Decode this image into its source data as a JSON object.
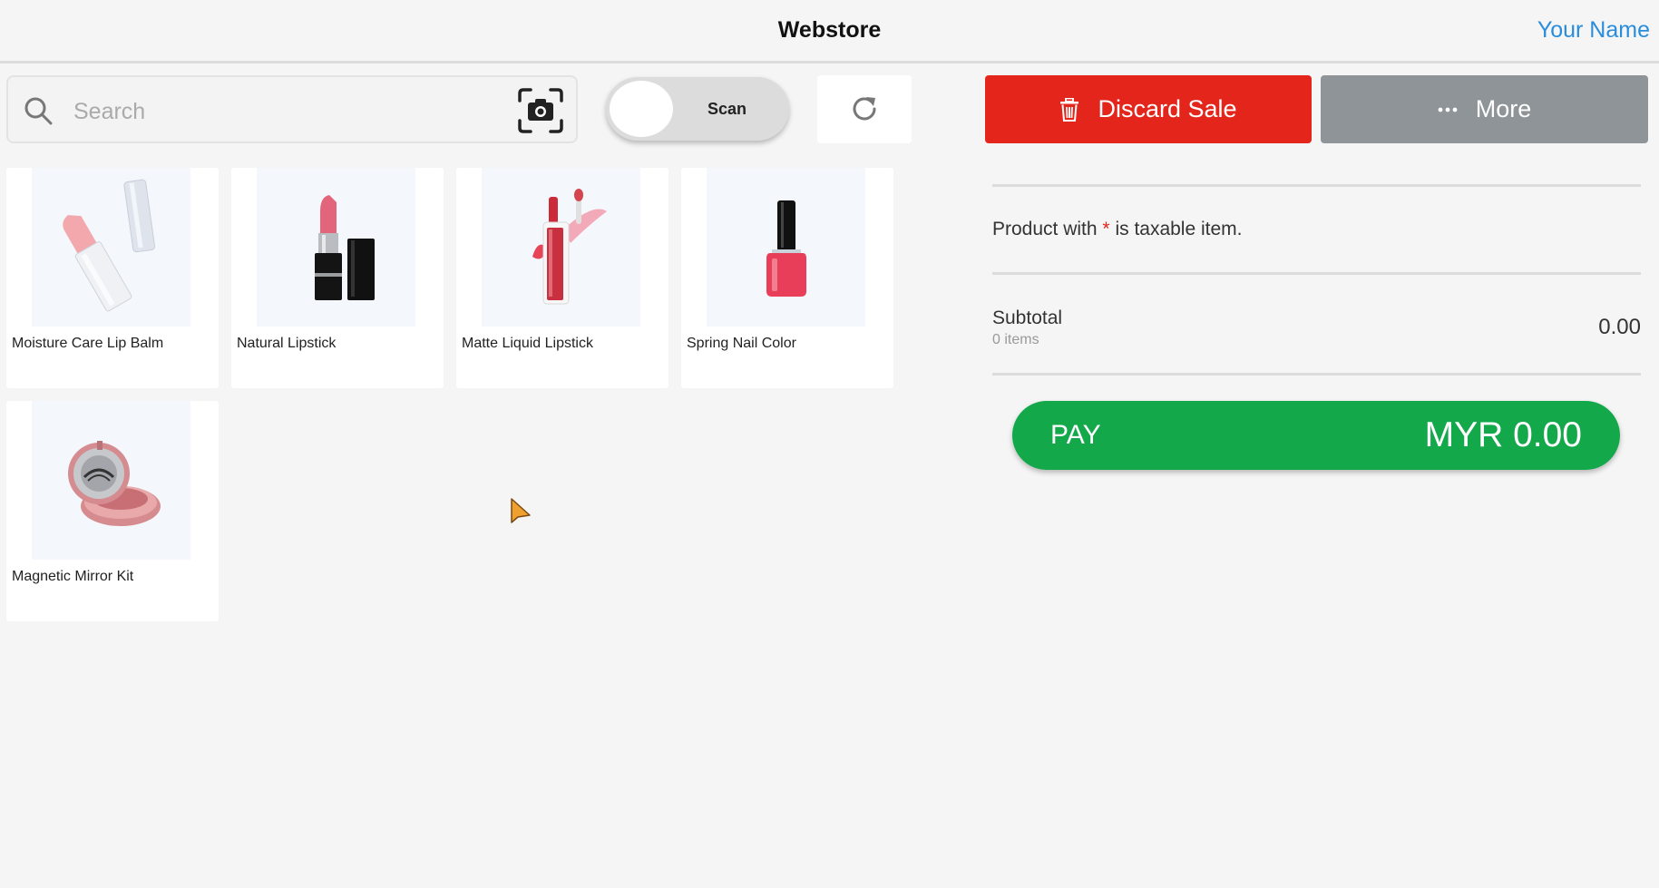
{
  "header": {
    "title": "Webstore",
    "user_name": "Your Name"
  },
  "search": {
    "placeholder": "Search",
    "value": ""
  },
  "scan_toggle": {
    "label": "Scan",
    "on": false
  },
  "actions": {
    "discard_label": "Discard Sale",
    "more_label": "More"
  },
  "products": [
    {
      "name": "Moisture Care Lip Balm",
      "icon": "lip-balm"
    },
    {
      "name": "Natural Lipstick",
      "icon": "lipstick"
    },
    {
      "name": "Matte Liquid Lipstick",
      "icon": "liquid-lipstick"
    },
    {
      "name": "Spring Nail Color",
      "icon": "nail-polish"
    },
    {
      "name": "Magnetic Mirror Kit",
      "icon": "mirror-kit"
    }
  ],
  "cart": {
    "tax_note_prefix": "Product with",
    "tax_note_star": "*",
    "tax_note_suffix": "is taxable item.",
    "subtotal_label": "Subtotal",
    "item_count": "0 items",
    "subtotal_value": "0.00"
  },
  "pay": {
    "label": "PAY",
    "amount": "MYR 0.00"
  },
  "colors": {
    "discard": "#e3251b",
    "more": "#8e9498",
    "pay": "#13a84a",
    "link": "#2a8ddb"
  }
}
